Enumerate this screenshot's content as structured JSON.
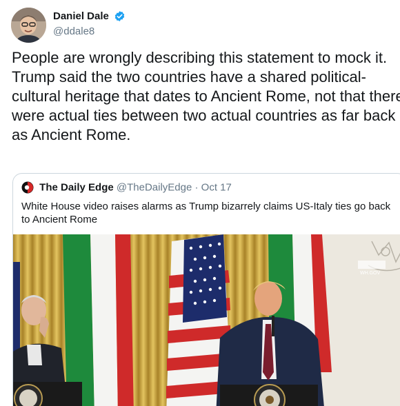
{
  "author": {
    "display_name": "Daniel Dale",
    "handle": "@ddale8",
    "avatar_icon": "person-avatar-icon",
    "verified_icon": "verified-badge-icon"
  },
  "tweet": {
    "text": "People are wrongly describing this statement to mock it. Trump said the two countries have a shared political-cultural heritage that dates to Ancient Rome, not that there were actual ties between two actual countries as far back as Ancient Rome."
  },
  "quote": {
    "logo_icon": "daily-edge-logo-icon",
    "name": "The Daily Edge",
    "handle": "@TheDailyEdge",
    "separator": "·",
    "date": "Oct 17",
    "text": "White House video raises alarms as Trump bizarrely claims US-Italy ties go back to Ancient Rome",
    "media_watermark": "WH.GOV"
  },
  "colors": {
    "verified": "#1da1f2",
    "secondary_text": "#657786",
    "border": "#ccd6dd",
    "curtain_gold": "#c9a341",
    "italy_green": "#1e8a3c",
    "italy_red": "#cf2a2a",
    "us_blue": "#1d2c6b"
  }
}
